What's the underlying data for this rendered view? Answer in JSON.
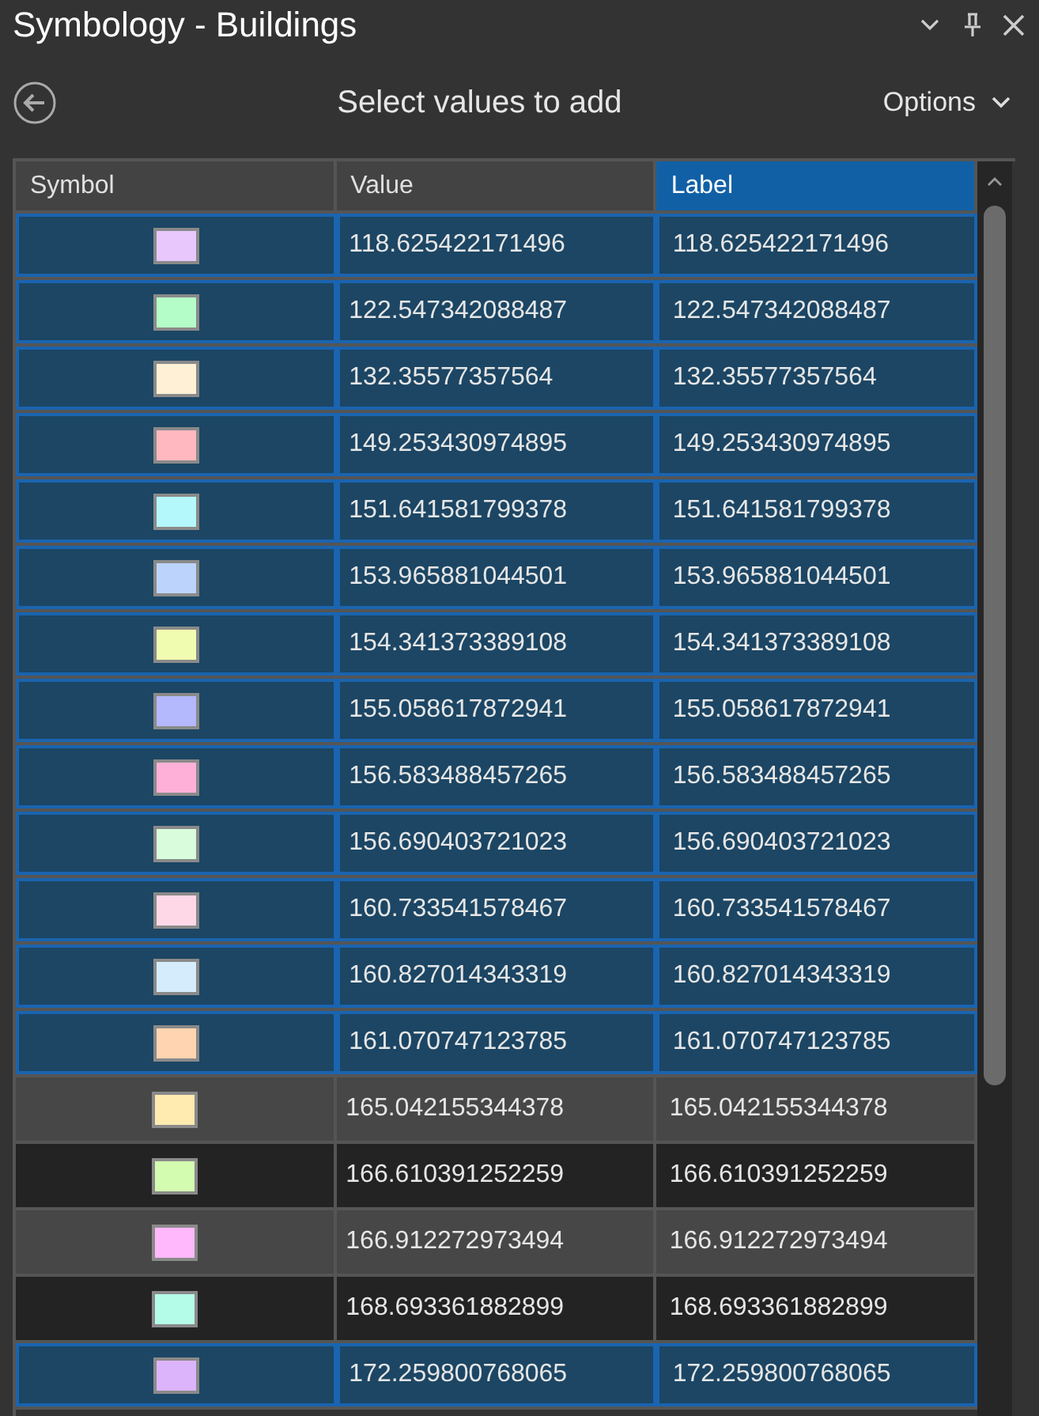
{
  "window": {
    "title": "Symbology - Buildings"
  },
  "toolbar": {
    "heading": "Select values to add",
    "options_label": "Options"
  },
  "table": {
    "columns": [
      {
        "label": "Symbol",
        "selected": false
      },
      {
        "label": "Value",
        "selected": false
      },
      {
        "label": "Label",
        "selected": true
      }
    ],
    "rows": [
      {
        "color": "#e8c8fc",
        "value": "118.625422171496",
        "label": "118.625422171496",
        "selected": true
      },
      {
        "color": "#b4fcc8",
        "value": "122.547342088487",
        "label": "122.547342088487",
        "selected": true
      },
      {
        "color": "#fff0d6",
        "value": "132.35577357564",
        "label": "132.35577357564",
        "selected": true
      },
      {
        "color": "#ffb8c0",
        "value": "149.253430974895",
        "label": "149.253430974895",
        "selected": true
      },
      {
        "color": "#b4f8fc",
        "value": "151.641581799378",
        "label": "151.641581799378",
        "selected": true
      },
      {
        "color": "#bcd4fc",
        "value": "153.965881044501",
        "label": "153.965881044501",
        "selected": true
      },
      {
        "color": "#f0fcb0",
        "value": "154.341373389108",
        "label": "154.341373389108",
        "selected": true
      },
      {
        "color": "#b4b8fc",
        "value": "155.058617872941",
        "label": "155.058617872941",
        "selected": true
      },
      {
        "color": "#ffb0d8",
        "value": "156.583488457265",
        "label": "156.583488457265",
        "selected": true
      },
      {
        "color": "#d8fcdc",
        "value": "156.690403721023",
        "label": "156.690403721023",
        "selected": true
      },
      {
        "color": "#ffd8e8",
        "value": "160.733541578467",
        "label": "160.733541578467",
        "selected": true
      },
      {
        "color": "#d4ecfc",
        "value": "160.827014343319",
        "label": "160.827014343319",
        "selected": true
      },
      {
        "color": "#ffd4b0",
        "value": "161.070747123785",
        "label": "161.070747123785",
        "selected": true
      },
      {
        "color": "#ffeab0",
        "value": "165.042155344378",
        "label": "165.042155344378",
        "selected": false
      },
      {
        "color": "#d4fcb0",
        "value": "166.610391252259",
        "label": "166.610391252259",
        "selected": false
      },
      {
        "color": "#ffb8fc",
        "value": "166.912272973494",
        "label": "166.912272973494",
        "selected": false
      },
      {
        "color": "#b4fce8",
        "value": "168.693361882899",
        "label": "168.693361882899",
        "selected": false
      },
      {
        "color": "#dcb4fc",
        "value": "172.259800768065",
        "label": "172.259800768065",
        "selected": true
      }
    ]
  }
}
